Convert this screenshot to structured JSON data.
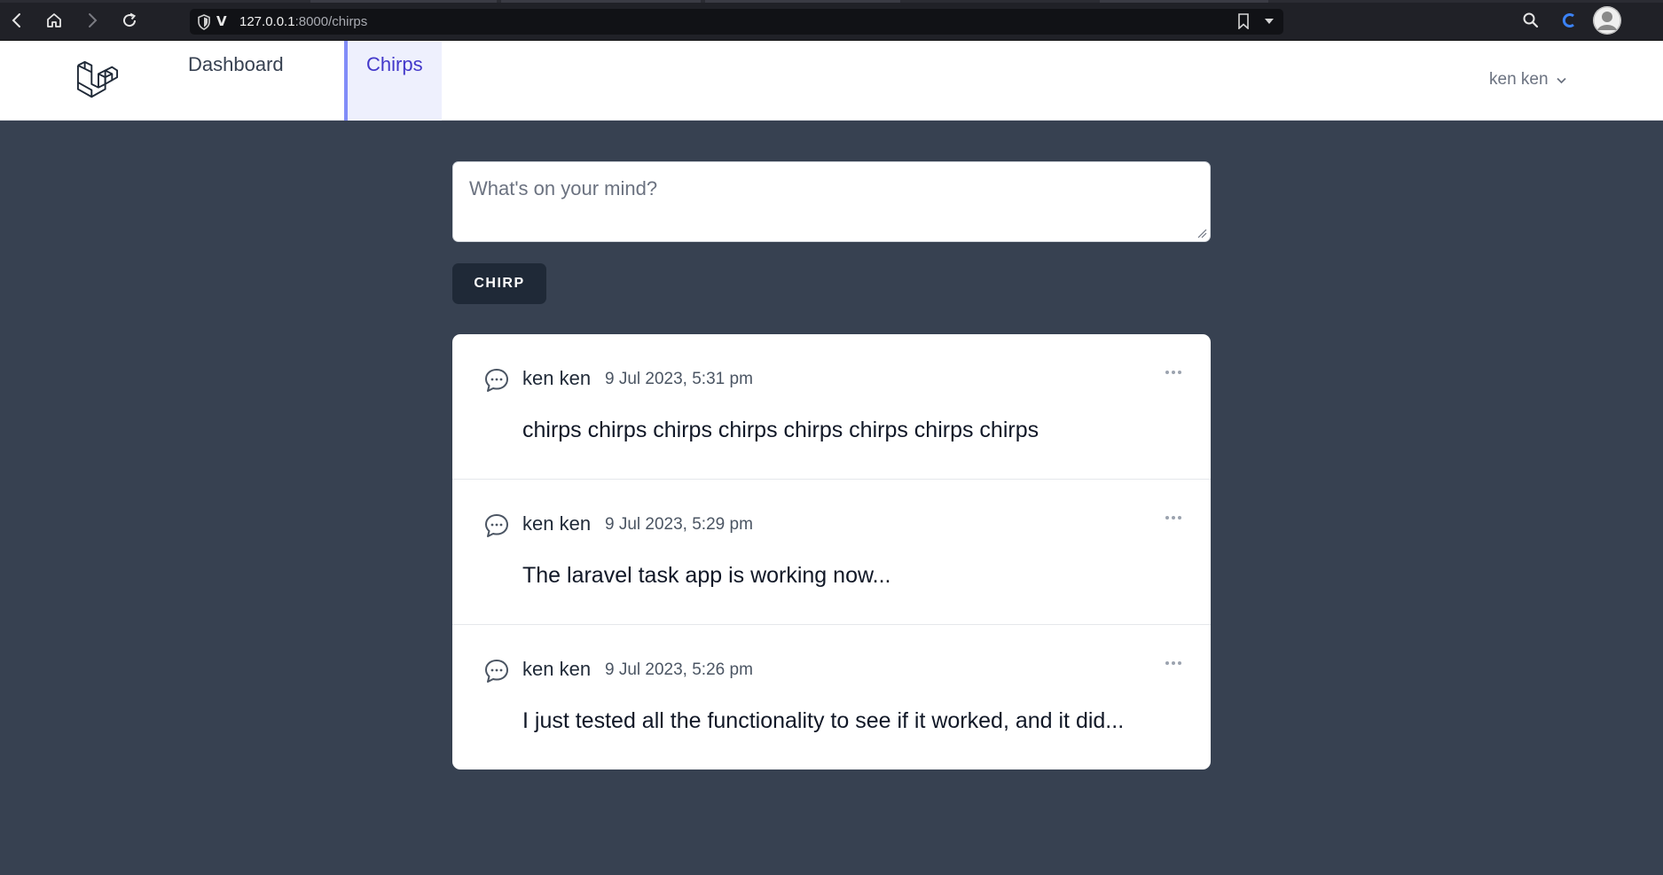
{
  "browser": {
    "url_host": "127.0.0.1",
    "url_path": ":8000/chirps"
  },
  "nav": {
    "links": [
      {
        "label": "Dashboard",
        "active": false
      },
      {
        "label": "Chirps",
        "active": true
      }
    ],
    "user_name": "ken ken"
  },
  "composer": {
    "placeholder": "What's on your mind?",
    "value": ""
  },
  "submit_label": "CHIRP",
  "chirps": [
    {
      "author": "ken ken",
      "time": "9 Jul 2023, 5:31 pm",
      "message": "chirps chirps chirps chirps chirps chirps chirps chirps"
    },
    {
      "author": "ken ken",
      "time": "9 Jul 2023, 5:29 pm",
      "message": "The laravel task app is working now..."
    },
    {
      "author": "ken ken",
      "time": "9 Jul 2023, 5:26 pm",
      "message": "I just tested all the functionality to see if it worked, and it did..."
    }
  ],
  "icons": {
    "logo": "laravel-logo",
    "chirp": "chat-bubble-icon",
    "more": "ellipsis-icon"
  },
  "colors": {
    "page_bg": "#374151",
    "active_tab_bg": "#eef0fd",
    "active_tab_border": "#818cf8",
    "active_tab_text": "#4338ca",
    "button_bg": "#1f2937"
  }
}
